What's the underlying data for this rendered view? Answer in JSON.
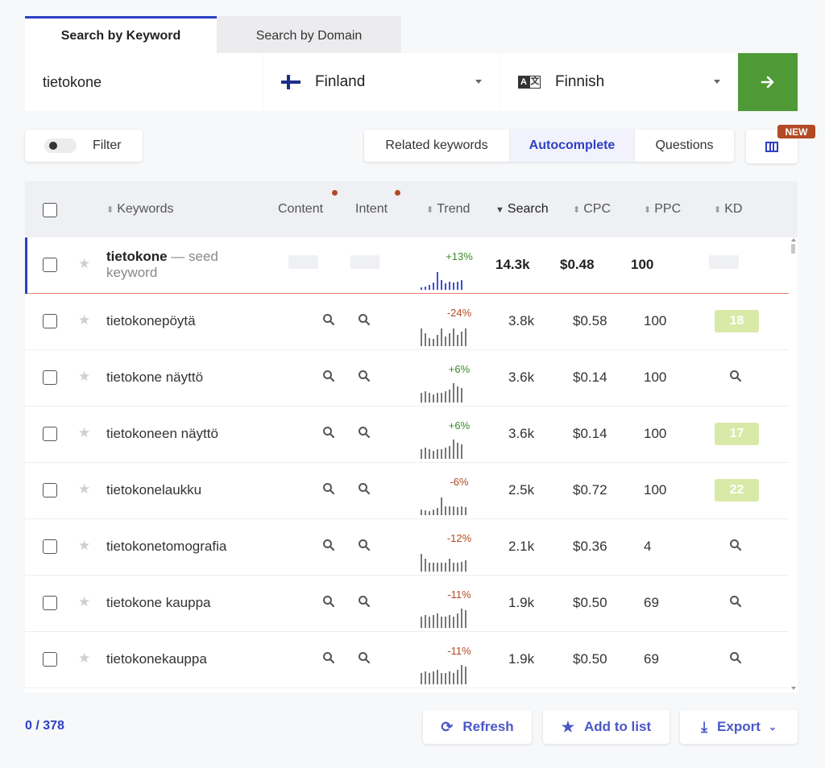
{
  "tabs": {
    "keyword": "Search by Keyword",
    "domain": "Search by Domain"
  },
  "search": {
    "keyword": "tietokone",
    "country": "Finland",
    "language": "Finnish",
    "language_icon_a": "A",
    "language_icon_b": "文"
  },
  "toolbar": {
    "filter": "Filter",
    "related": "Related keywords",
    "autocomplete": "Autocomplete",
    "questions": "Questions",
    "new_badge": "NEW"
  },
  "table": {
    "headers": {
      "keywords": "Keywords",
      "content": "Content",
      "intent": "Intent",
      "trend": "Trend",
      "search": "Search",
      "cpc": "CPC",
      "ppc": "PPC",
      "kd": "KD"
    },
    "seed": {
      "keyword": "tietokone",
      "suffix": " — seed keyword",
      "trend": "+13%",
      "search": "14.3k",
      "cpc": "$0.48",
      "ppc": "100"
    },
    "rows": [
      {
        "keyword": "tietokonepöytä",
        "trend": "-24%",
        "search": "3.8k",
        "cpc": "$0.58",
        "ppc": "100",
        "kd": "18"
      },
      {
        "keyword": "tietokone näyttö",
        "trend": "+6%",
        "search": "3.6k",
        "cpc": "$0.14",
        "ppc": "100",
        "kd": ""
      },
      {
        "keyword": "tietokoneen näyttö",
        "trend": "+6%",
        "search": "3.6k",
        "cpc": "$0.14",
        "ppc": "100",
        "kd": "17"
      },
      {
        "keyword": "tietokonelaukku",
        "trend": "-6%",
        "search": "2.5k",
        "cpc": "$0.72",
        "ppc": "100",
        "kd": "22"
      },
      {
        "keyword": "tietokonetomografia",
        "trend": "-12%",
        "search": "2.1k",
        "cpc": "$0.36",
        "ppc": "4",
        "kd": ""
      },
      {
        "keyword": "tietokone kauppa",
        "trend": "-11%",
        "search": "1.9k",
        "cpc": "$0.50",
        "ppc": "69",
        "kd": ""
      },
      {
        "keyword": "tietokonekauppa",
        "trend": "-11%",
        "search": "1.9k",
        "cpc": "$0.50",
        "ppc": "69",
        "kd": ""
      }
    ]
  },
  "footer": {
    "count": "0 / 378",
    "refresh": "Refresh",
    "add_to_list": "Add to list",
    "export": "Export"
  },
  "colors": {
    "accent": "#2d3fc4",
    "go": "#4f9a37",
    "badge": "#b24a25",
    "kd_bg": "#d9e9a8",
    "up": "#3a8a2a",
    "down": "#b24a25"
  },
  "icons": {
    "go": "arrow-right-icon",
    "filter": "toggle-icon",
    "columns": "columns-icon",
    "search_cell": "search-icon",
    "star": "star-icon",
    "refresh": "refresh-icon",
    "add": "star-icon",
    "export": "download-icon"
  }
}
